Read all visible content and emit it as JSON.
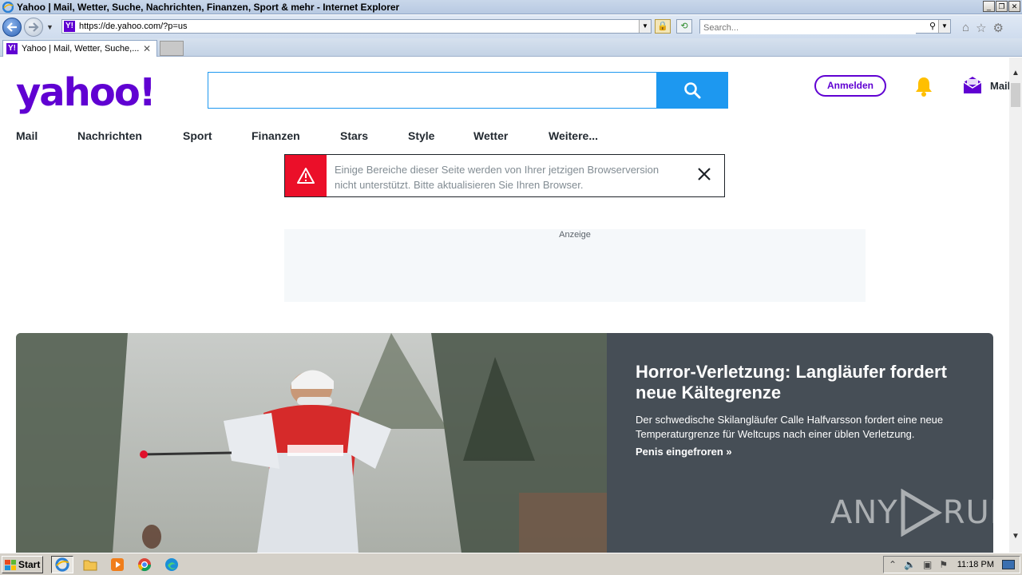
{
  "window": {
    "title": "Yahoo | Mail, Wetter, Suche, Nachrichten, Finanzen, Sport & mehr - Internet Explorer",
    "address_url": "https://de.yahoo.com/?p=us",
    "search_placeholder": "Search...",
    "tab_title": "Yahoo | Mail, Wetter, Suche,...",
    "tab_favicon": "Y!"
  },
  "header": {
    "logo_text": "yahoo!",
    "search_value": "",
    "signin_label": "Anmelden",
    "mail_label": "Mail"
  },
  "nav": {
    "items": [
      "Mail",
      "Nachrichten",
      "Sport",
      "Finanzen",
      "Stars",
      "Style",
      "Wetter",
      "Weitere..."
    ]
  },
  "alert": {
    "message": "Einige Bereiche dieser Seite werden von Ihrer jetzigen Browserversion nicht unterstützt. Bitte aktualisieren Sie Ihren Browser."
  },
  "ad": {
    "label": "Anzeige"
  },
  "hero": {
    "title": "Horror-Verletzung: Langläufer fordert neue Kältegrenze",
    "description": "Der schwedische Skilangläufer Calle Halfvarsson fordert eine neue Temperaturgrenze für Weltcups nach einer üblen Verletzung.",
    "link": "Penis eingefroren »"
  },
  "watermark": {
    "left": "ANY",
    "right": "RUN"
  },
  "taskbar": {
    "start_label": "Start",
    "clock": "11:18 PM"
  },
  "colors": {
    "brand": "#6001d2",
    "search_blue": "#1d98f0",
    "alert_red": "#eb0f29",
    "hero_bg": "#464e56"
  }
}
